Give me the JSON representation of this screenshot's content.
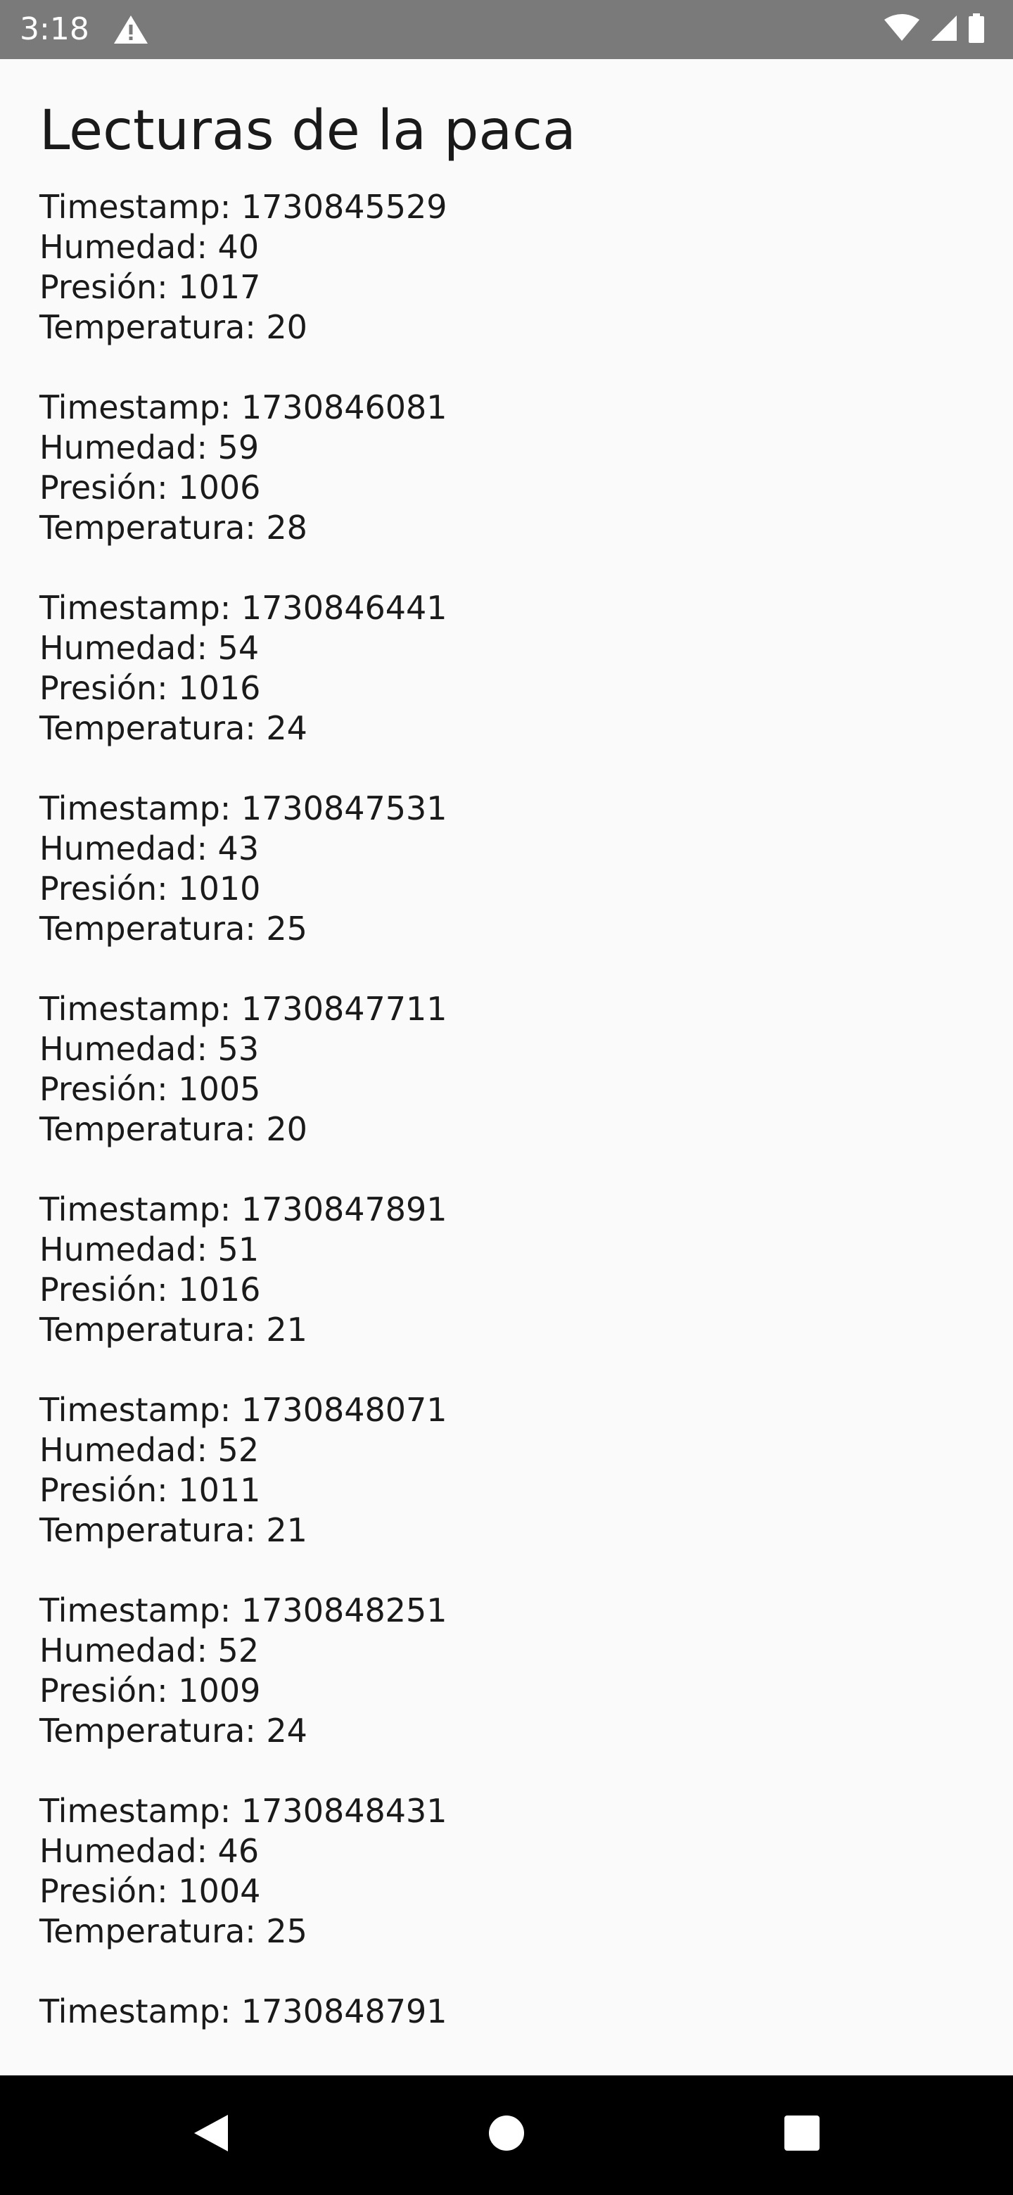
{
  "status_bar": {
    "time": "3:18",
    "background": "#7a7a7a",
    "icons": [
      "warning-icon",
      "wifi-icon",
      "signal-icon",
      "battery-icon"
    ]
  },
  "page": {
    "title": "Lecturas de la paca",
    "background": "#fafafa",
    "text_color": "#1a1a1a"
  },
  "readings": [
    {
      "timestamp": "Timestamp: 1730845529",
      "humedad": "Humedad: 40",
      "presion": "Presión: 1017",
      "temperatura": "Temperatura: 20"
    },
    {
      "timestamp": "Timestamp: 1730846081",
      "humedad": "Humedad: 59",
      "presion": "Presión: 1006",
      "temperatura": "Temperatura: 28"
    },
    {
      "timestamp": "Timestamp: 1730846441",
      "humedad": "Humedad: 54",
      "presion": "Presión: 1016",
      "temperatura": "Temperatura: 24"
    },
    {
      "timestamp": "Timestamp: 1730847531",
      "humedad": "Humedad: 43",
      "presion": "Presión: 1010",
      "temperatura": "Temperatura: 25"
    },
    {
      "timestamp": "Timestamp: 1730847711",
      "humedad": "Humedad: 53",
      "presion": "Presión: 1005",
      "temperatura": "Temperatura: 20"
    },
    {
      "timestamp": "Timestamp: 1730847891",
      "humedad": "Humedad: 51",
      "presion": "Presión: 1016",
      "temperatura": "Temperatura: 21"
    },
    {
      "timestamp": "Timestamp: 1730848071",
      "humedad": "Humedad: 52",
      "presion": "Presión: 1011",
      "temperatura": "Temperatura: 21"
    },
    {
      "timestamp": "Timestamp: 1730848251",
      "humedad": "Humedad: 52",
      "presion": "Presión: 1009",
      "temperatura": "Temperatura: 24"
    },
    {
      "timestamp": "Timestamp: 1730848431",
      "humedad": "Humedad: 46",
      "presion": "Presión: 1004",
      "temperatura": "Temperatura: 25"
    },
    {
      "timestamp": "Timestamp: 1730848791"
    }
  ],
  "nav_bar": {
    "background": "#000000",
    "buttons": [
      "back-icon",
      "home-icon",
      "recents-icon"
    ]
  }
}
